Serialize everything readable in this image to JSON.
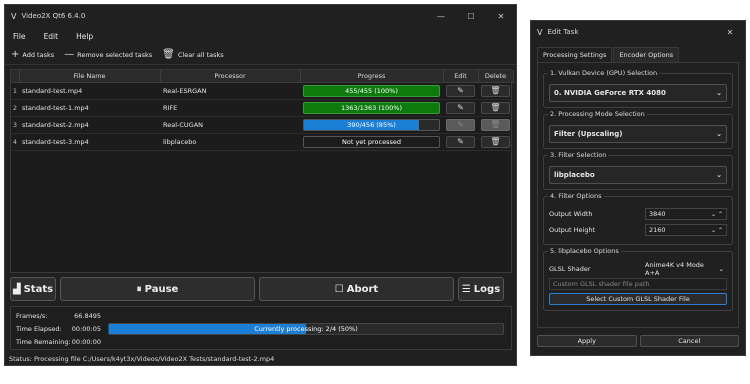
{
  "main_window": {
    "title": "Video2X Qt6 6.4.0",
    "app_icon": "video2x-icon",
    "controls": {
      "minimize": "—",
      "maximize": "☐",
      "close": "✕"
    },
    "menu": [
      "File",
      "Edit",
      "Help"
    ],
    "toolbar": {
      "add_tasks": "Add tasks",
      "remove_selected": "Remove selected tasks",
      "clear_all": "Clear all tasks"
    },
    "table": {
      "headers": [
        "File Name",
        "Processor",
        "Progress",
        "Edit",
        "Delete"
      ],
      "rows": [
        {
          "index": "1",
          "file": "standard-test.mp4",
          "processor": "Real-ESRGAN",
          "progress": "455/455 (100%)",
          "state": "done",
          "progress_value": 1.0
        },
        {
          "index": "2",
          "file": "standard-test-1.mp4",
          "processor": "RIFE",
          "progress": "1363/1363 (100%)",
          "state": "done",
          "progress_value": 1.0
        },
        {
          "index": "3",
          "file": "standard-test-2.mp4",
          "processor": "Real-CUGAN",
          "progress": "390/456 (85%)",
          "state": "running",
          "progress_value": 0.85
        },
        {
          "index": "4",
          "file": "standard-test-3.mp4",
          "processor": "libplacebo",
          "progress": "Not yet processed",
          "state": "pending",
          "progress_value": 0
        }
      ]
    },
    "buttons": {
      "stats": "Stats",
      "pause": "Pause",
      "abort": "Abort",
      "logs": "Logs"
    },
    "stats": {
      "frames_label": "Frames/s:",
      "frames_value": "66.8495",
      "elapsed_label": "Time Elapsed:",
      "elapsed_value": "00:00:05",
      "remaining_label": "Time Remaining:",
      "remaining_value": "00:00:00",
      "overall_progress": "Currently processing: 2/4 (50%)",
      "overall_value": 0.5
    },
    "status": "Status: Processing file C:/Users/k4yt3x/Videos/Video2X Tests/standard-test-2.mp4"
  },
  "dialog": {
    "title": "Edit Task",
    "close": "✕",
    "tabs": [
      "Processing Settings",
      "Encoder Options"
    ],
    "groups": {
      "gpu": {
        "title": "1. Vulkan Device (GPU) Selection",
        "value": "0. NVIDIA GeForce RTX 4080"
      },
      "mode": {
        "title": "2. Processing Mode Selection",
        "value": "Filter (Upscaling)"
      },
      "filter": {
        "title": "3. Filter Selection",
        "value": "libplacebo"
      },
      "options": {
        "title": "4. Filter Options",
        "width_label": "Output Width",
        "width_value": "3840",
        "height_label": "Output Height",
        "height_value": "2160"
      },
      "libplacebo": {
        "title": "5. libplacebo Options",
        "shader_label": "GLSL Shader",
        "shader_value": "Anime4K v4 Mode A+A",
        "path_placeholder": "Custom GLSL shader file path",
        "select_button": "Select Custom GLSL Shader File"
      }
    },
    "apply": "Apply",
    "cancel": "Cancel"
  }
}
